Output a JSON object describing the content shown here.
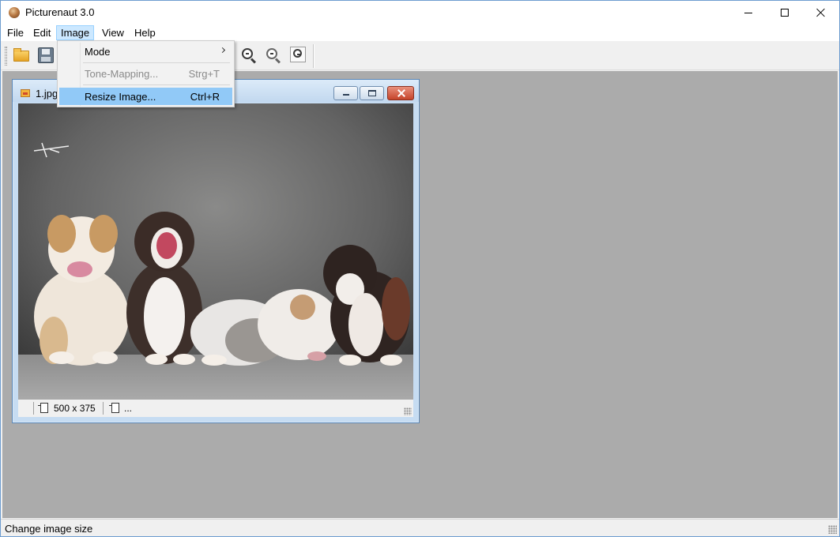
{
  "window": {
    "title": "Picturenaut 3.0"
  },
  "menubar": {
    "items": [
      "File",
      "Edit",
      "Image",
      "View",
      "Help"
    ]
  },
  "image_menu": {
    "items": [
      {
        "label": "Mode",
        "shortcut": ""
      },
      {
        "label": "Tone-Mapping...",
        "shortcut": "Strg+T"
      },
      {
        "label": "Resize Image...",
        "shortcut": "Ctrl+R"
      }
    ]
  },
  "document": {
    "title": "1.jpg",
    "image_size": "500 x 375",
    "extra_info": "..."
  },
  "statusbar": {
    "text": "Change image size"
  },
  "colors": {
    "workspace": "#ababab",
    "menu_highlight": "#91c9f7",
    "child_frame": "#c6dcf2"
  }
}
